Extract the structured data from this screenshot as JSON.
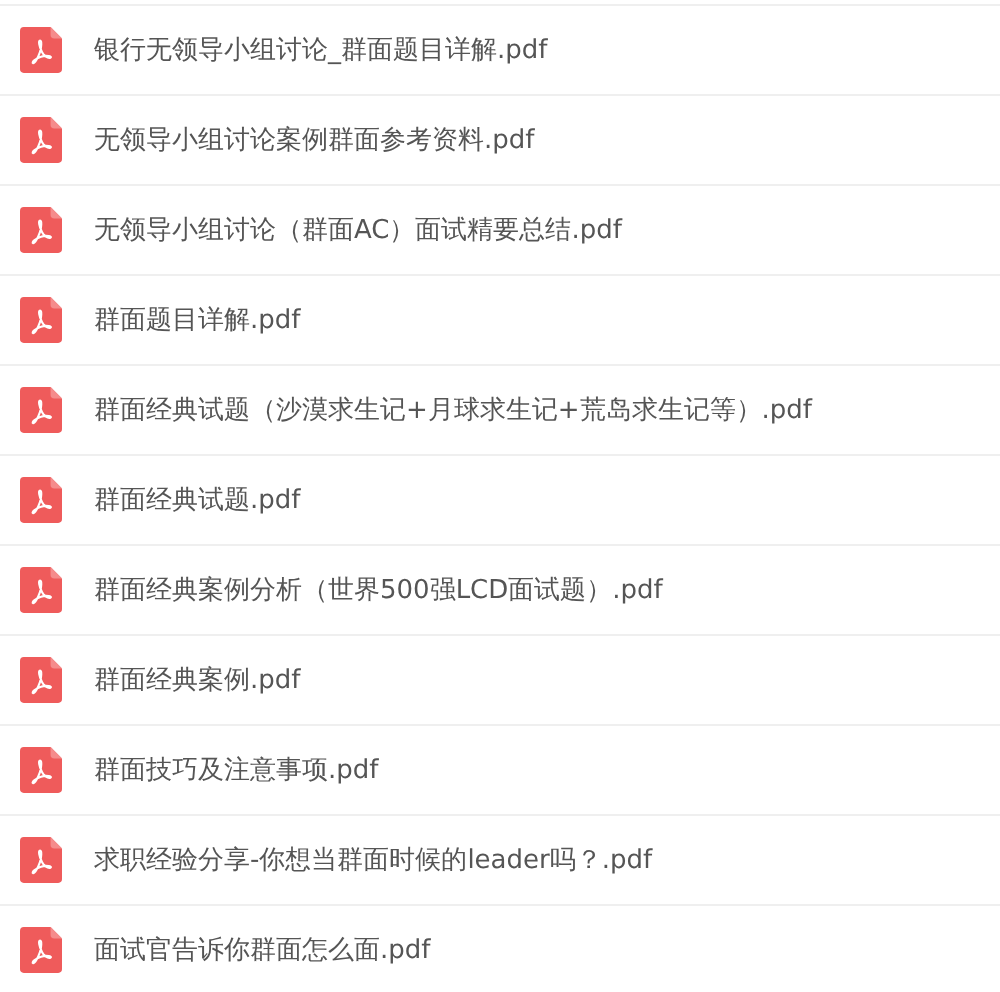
{
  "files": [
    {
      "name": "银行无领导小组讨论_群面题目详解.pdf",
      "kind": "pdf"
    },
    {
      "name": "无领导小组讨论案例群面参考资料.pdf",
      "kind": "pdf"
    },
    {
      "name": "无领导小组讨论（群面AC）面试精要总结.pdf",
      "kind": "pdf"
    },
    {
      "name": "群面题目详解.pdf",
      "kind": "pdf"
    },
    {
      "name": "群面经典试题（沙漠求生记+月球求生记+荒岛求生记等）.pdf",
      "kind": "pdf"
    },
    {
      "name": "群面经典试题.pdf",
      "kind": "pdf"
    },
    {
      "name": "群面经典案例分析（世界500强LCD面试题）.pdf",
      "kind": "pdf"
    },
    {
      "name": "群面经典案例.pdf",
      "kind": "pdf"
    },
    {
      "name": "群面技巧及注意事项.pdf",
      "kind": "pdf"
    },
    {
      "name": "求职经验分享-你想当群面时候的leader吗？.pdf",
      "kind": "pdf"
    },
    {
      "name": "面试官告诉你群面怎么面.pdf",
      "kind": "pdf"
    }
  ]
}
